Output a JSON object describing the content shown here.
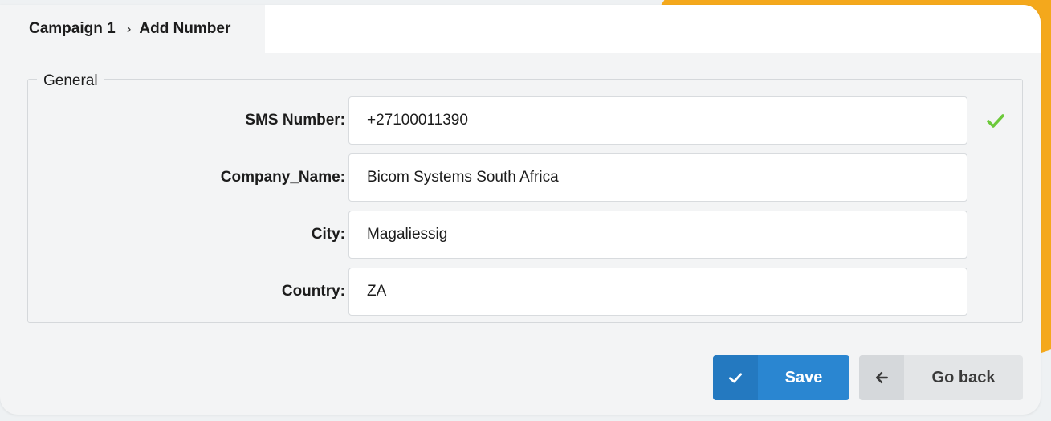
{
  "breadcrumb": {
    "parent": "Campaign 1",
    "separator": "›",
    "current": "Add Number"
  },
  "section": {
    "legend": "General"
  },
  "form": {
    "fields": [
      {
        "label": "SMS Number:",
        "value": "+27100011390",
        "validated": true
      },
      {
        "label": "Company_Name:",
        "value": "Bicom Systems South Africa"
      },
      {
        "label": "City:",
        "value": "Magaliessig"
      },
      {
        "label": "Country:",
        "value": "ZA"
      }
    ]
  },
  "actions": {
    "save_label": "Save",
    "go_back_label": "Go back"
  },
  "colors": {
    "accent_orange": "#f4a81c",
    "save_blue": "#2a86d1",
    "valid_green": "#6cc93a"
  },
  "icons": {
    "valid": "check-icon",
    "save": "check-icon",
    "back": "arrow-left-icon"
  }
}
